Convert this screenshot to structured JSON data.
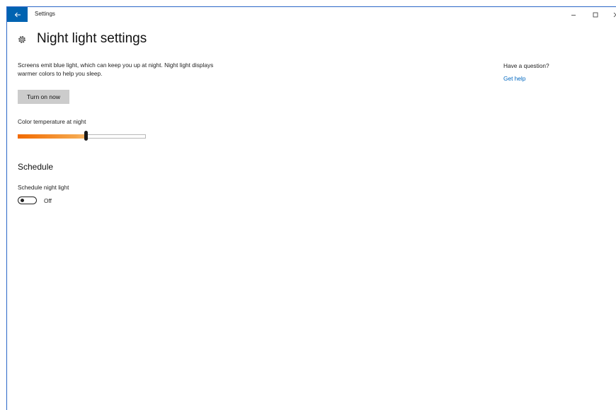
{
  "window": {
    "app_title": "Settings",
    "controls": {
      "minimize_icon": "minimize-icon",
      "maximize_icon": "maximize-icon",
      "close_icon": "close-icon"
    },
    "back_icon": "back-arrow-icon",
    "accent_color": "#0063b1"
  },
  "header": {
    "icon": "gear-icon",
    "title": "Night light settings"
  },
  "main": {
    "description": "Screens emit blue light, which can keep you up at night. Night light displays warmer colors to help you sleep.",
    "turn_on_button": "Turn on now",
    "color_temperature": {
      "label": "Color temperature at night",
      "value_fraction": 0.53,
      "gradient_colors": [
        "#f26a00",
        "#f5a54a",
        "#fce2b8",
        "#fffaf0"
      ]
    },
    "schedule": {
      "heading": "Schedule",
      "toggle_label": "Schedule night light",
      "toggle_state_text": "Off",
      "toggle_on": false
    }
  },
  "help": {
    "heading": "Have a question?",
    "link_text": "Get help",
    "link_color": "#0067c0"
  }
}
